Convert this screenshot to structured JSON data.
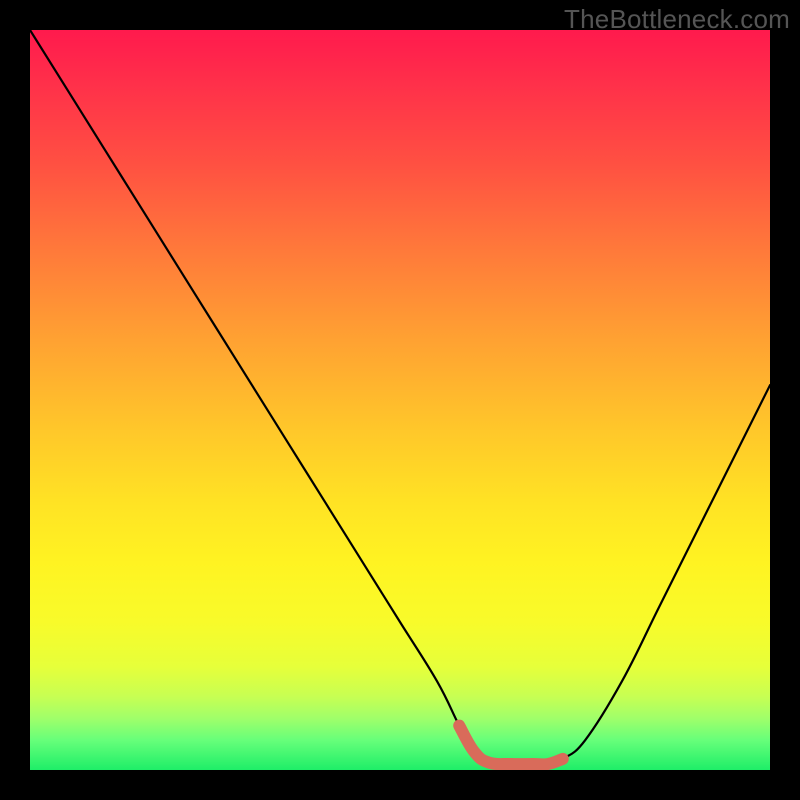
{
  "header": {
    "watermark": "TheBottleneck.com"
  },
  "chart_data": {
    "type": "line",
    "title": "",
    "xlabel": "",
    "ylabel": "",
    "xlim": [
      0,
      100
    ],
    "ylim": [
      0,
      100
    ],
    "grid": false,
    "legend": false,
    "x": [
      0,
      5,
      10,
      15,
      20,
      25,
      30,
      35,
      40,
      45,
      50,
      55,
      58,
      60,
      62,
      65,
      68,
      70,
      72,
      75,
      80,
      85,
      90,
      95,
      100
    ],
    "values": [
      100,
      92,
      84,
      76,
      68,
      60,
      52,
      44,
      36,
      28,
      20,
      12,
      6,
      2.5,
      1,
      0.3,
      0.3,
      0.6,
      1.5,
      4,
      12,
      22,
      32,
      42,
      52
    ],
    "baseline_range_x": [
      58,
      72
    ],
    "notes": "Single V-shaped curve over a vertical severity gradient (red at top to green at bottom). Minimum (best) occurs roughly between x≈58 and x≈72. A short thick coral segment overlays the curve near its minimum. Values are read as percent of the vertical extent; no axis ticks or numeric labels are shown in the source image, so values are estimated from geometry."
  },
  "colors": {
    "curve": "#000000",
    "baseline_highlight": "#d96b5a",
    "frame": "#000000",
    "watermark": "#555555"
  }
}
